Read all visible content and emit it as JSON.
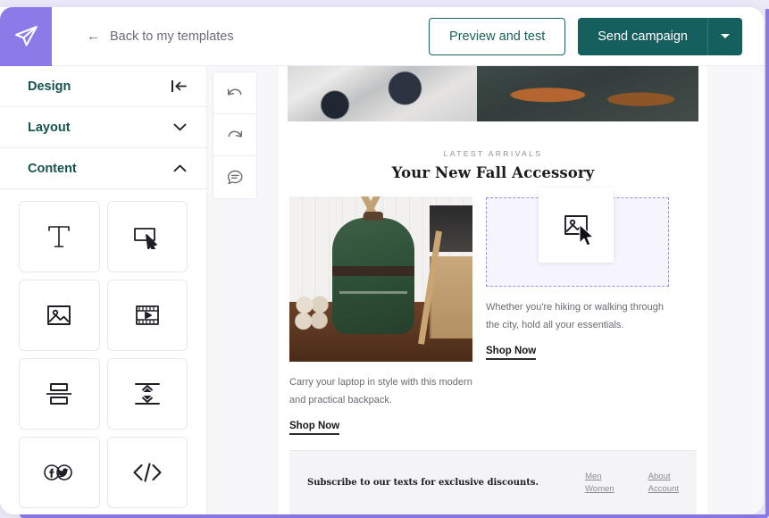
{
  "brand": {
    "logo_icon": "paper-plane-icon",
    "accent_purple": "#8b7ae8",
    "accent_teal": "#15605e"
  },
  "topbar": {
    "back_arrow": "←",
    "back_label": "Back to my templates",
    "preview_label": "Preview and test",
    "send_label": "Send campaign",
    "send_caret_icon": "caret-down-icon"
  },
  "sidebar": {
    "sections": [
      {
        "label": "Design",
        "icon": "collapse-panel-icon",
        "expanded": false
      },
      {
        "label": "Layout",
        "icon": "chevron-down-icon",
        "expanded": false
      },
      {
        "label": "Content",
        "icon": "chevron-up-icon",
        "expanded": true
      }
    ],
    "content_tiles": [
      {
        "name": "text-block",
        "icon": "text-t-icon"
      },
      {
        "name": "button-block",
        "icon": "button-cursor-icon"
      },
      {
        "name": "image-block",
        "icon": "image-icon"
      },
      {
        "name": "video-block",
        "icon": "video-film-icon"
      },
      {
        "name": "split-block",
        "icon": "split-rows-icon"
      },
      {
        "name": "spacer-block",
        "icon": "spacer-icon"
      },
      {
        "name": "social-block",
        "icon": "social-icons-icon"
      },
      {
        "name": "html-block",
        "icon": "code-brackets-icon"
      }
    ]
  },
  "toolbar": {
    "buttons": [
      {
        "name": "undo",
        "icon": "undo-arrow-icon"
      },
      {
        "name": "redo",
        "icon": "redo-arrow-icon"
      },
      {
        "name": "comments",
        "icon": "comment-bubble-icon"
      }
    ]
  },
  "email": {
    "hero": {
      "left_image_alt": "boots-on-snow-photo",
      "right_image_alt": "brown-leather-boots-photo"
    },
    "eyebrow": "LATEST ARRIVALS",
    "headline": "Your New Fall Accessory",
    "left_column": {
      "image_alt": "green-backpack-photo",
      "body": "Carry your laptop in style with this modern and practical backpack.",
      "cta": "Shop Now"
    },
    "right_column": {
      "dropzone_state": "active-drop-target",
      "dragged_block_icon": "image-icon",
      "cursor_icon": "mouse-pointer-icon",
      "body": "Whether you're hiking or walking through the city, hold all your essentials.",
      "cta": "Shop Now"
    },
    "footer": {
      "headline": "Subscribe to our texts for exclusive discounts.",
      "links_col1": [
        "Men",
        "Women"
      ],
      "links_col2": [
        "About",
        "Account"
      ]
    }
  }
}
